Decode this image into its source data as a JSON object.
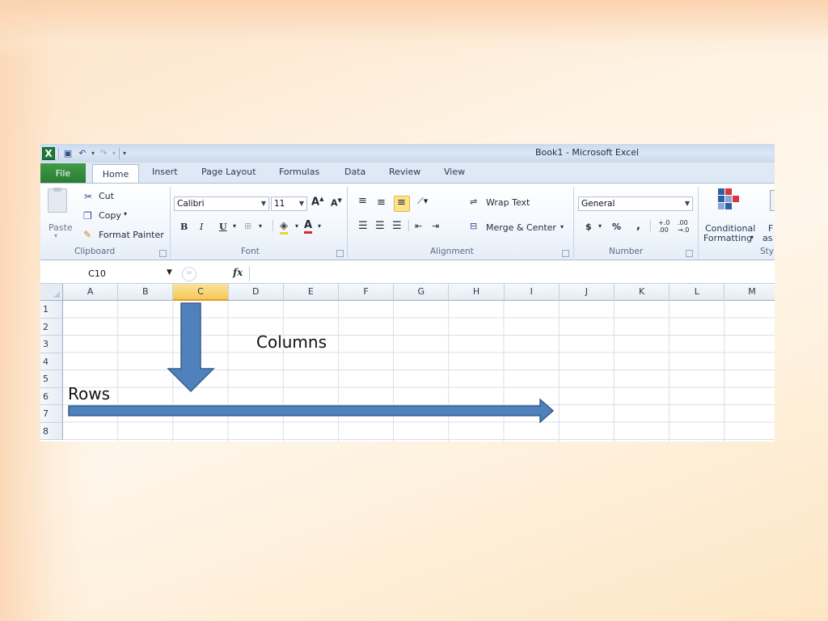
{
  "window": {
    "title": "Book1 - Microsoft Excel",
    "app_logo": "X"
  },
  "ribbon_tabs": [
    "File",
    "Home",
    "Insert",
    "Page Layout",
    "Formulas",
    "Data",
    "Review",
    "View"
  ],
  "clipboard": {
    "paste": "Paste",
    "cut": "Cut",
    "copy": "Copy",
    "format_painter": "Format Painter",
    "group": "Clipboard"
  },
  "font": {
    "name": "Calibri",
    "size": "11",
    "bold": "B",
    "italic": "I",
    "underline": "U",
    "group": "Font"
  },
  "alignment": {
    "wrap_text": "Wrap Text",
    "merge_center": "Merge & Center",
    "group": "Alignment"
  },
  "number": {
    "format": "General",
    "currency": "$",
    "percent": "%",
    "comma": ",",
    "group": "Number"
  },
  "styles": {
    "conditional_line1": "Conditional",
    "conditional_line2": "Formatting",
    "format_line1": "F",
    "format_line2": "as",
    "group": "Sty"
  },
  "formula_bar": {
    "name_box": "C10",
    "fx": "fx",
    "value": ""
  },
  "grid": {
    "columns": [
      "A",
      "B",
      "C",
      "D",
      "E",
      "F",
      "G",
      "H",
      "I",
      "J",
      "K",
      "L",
      "M"
    ],
    "rows": [
      "1",
      "2",
      "3",
      "4",
      "5",
      "6",
      "7",
      "8"
    ],
    "selected_column": "C"
  },
  "annotations": {
    "columns": "Columns",
    "rows": "Rows",
    "arrow_color": "#4f81bd"
  }
}
